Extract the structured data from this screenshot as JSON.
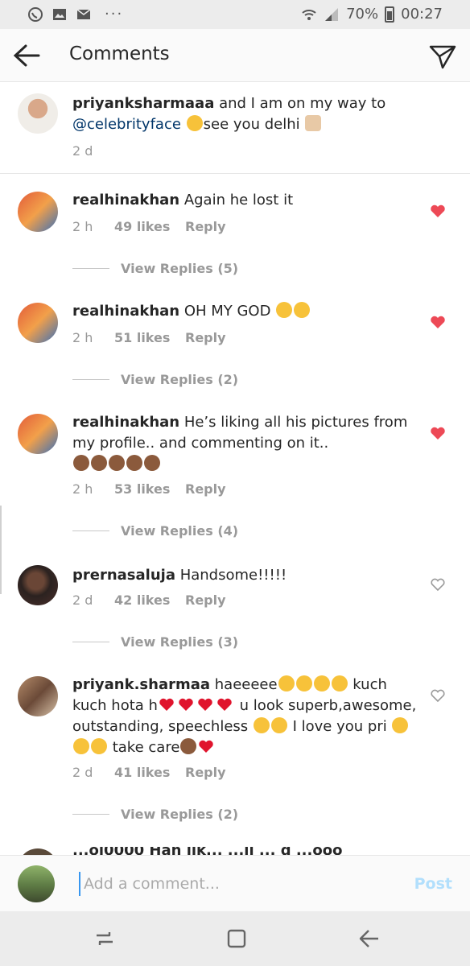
{
  "status_bar": {
    "battery": "70%",
    "time": "00:27",
    "icons": [
      "whatsapp-icon",
      "gallery-icon",
      "mail-icon",
      "more-icon",
      "wifi-icon",
      "signal-icon",
      "battery-icon"
    ],
    "overflow": "···"
  },
  "header": {
    "title": "Comments",
    "back_icon": "arrow-left-icon",
    "send_icon": "direct-send-icon"
  },
  "caption": {
    "username": "priyanksharmaaa",
    "text_before": " and I am on my way to",
    "mention": "@celebrityface",
    "text_after": "see you delhi",
    "time": "2 d"
  },
  "comments": [
    {
      "username": "realhinakhan",
      "text": " Again he lost it",
      "time": "2 h",
      "likes": "49 likes",
      "reply": "Reply",
      "view_replies": "View Replies (5)",
      "liked": true
    },
    {
      "username": "realhinakhan",
      "text": " OH MY GOD",
      "time": "2 h",
      "likes": "51 likes",
      "reply": "Reply",
      "view_replies": "View Replies (2)",
      "liked": true
    },
    {
      "username": "realhinakhan",
      "text": " He’s liking all his pictures from my profile.. and commenting on it..",
      "time": "2 h",
      "likes": "53 likes",
      "reply": "Reply",
      "view_replies": "View Replies (4)",
      "liked": true
    },
    {
      "username": "prernasaluja",
      "text": " Handsome!!!!!",
      "time": "2 d",
      "likes": "42 likes",
      "reply": "Reply",
      "view_replies": "View Replies (3)",
      "liked": false
    },
    {
      "username": "priyank.sharmaa",
      "text_1": " haeeeee",
      "text_2": " kuch kuch hota h",
      "text_3": " u look superb,awesome, outstanding, speechless",
      "text_4": " I love you pri",
      "text_5": " take care",
      "time": "2 d",
      "likes": "41 likes",
      "reply": "Reply",
      "view_replies": "View Replies (2)",
      "liked": false
    }
  ],
  "partial_comment": {
    "text": "...ol0000 Hah lik... ...ll ... d ...ooo"
  },
  "input_bar": {
    "placeholder": "Add a comment...",
    "post_label": "Post"
  },
  "colors": {
    "liked_heart": "#ed4956",
    "mention": "#003569",
    "meta_gray": "#999999",
    "post_disabled": "#b2dffc"
  },
  "nav_bar": {
    "icons": [
      "recent-apps-icon",
      "home-icon",
      "back-icon"
    ]
  }
}
